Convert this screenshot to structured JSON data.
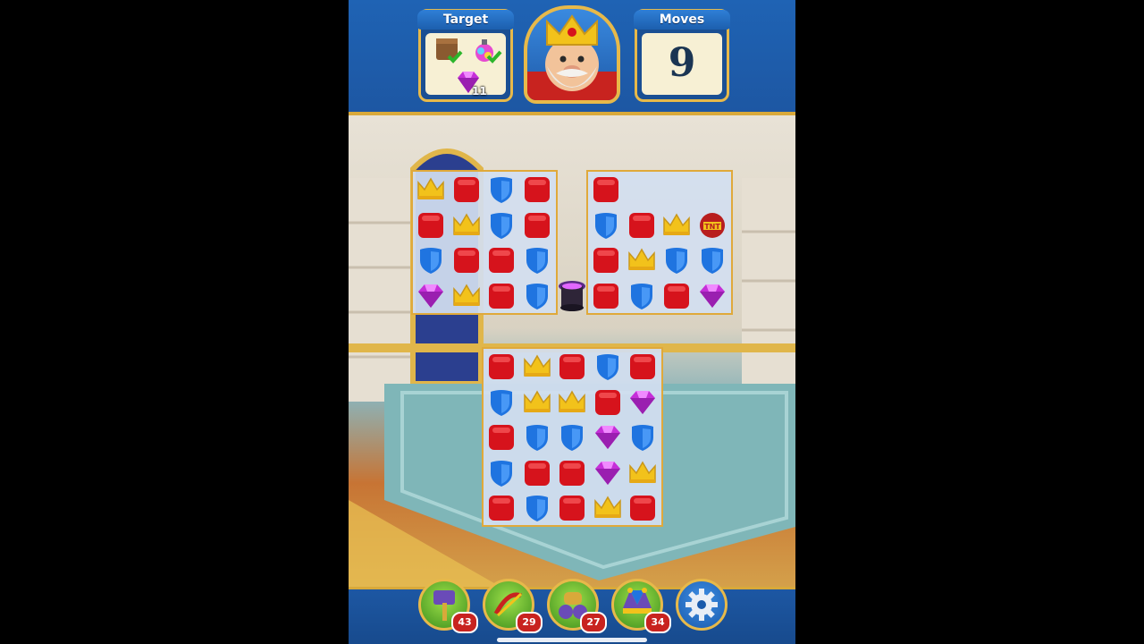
{
  "hud": {
    "target_label": "Target",
    "moves_label": "Moves",
    "moves_value": "9",
    "targets": [
      {
        "icon": "box-icon",
        "done": true
      },
      {
        "icon": "potion-icon",
        "done": true
      },
      {
        "icon": "gem-icon",
        "remaining": "11"
      }
    ]
  },
  "boosters": [
    {
      "icon": "hammer-icon",
      "count": "43"
    },
    {
      "icon": "arrow-icon",
      "count": "29"
    },
    {
      "icon": "cannon-icon",
      "count": "27"
    },
    {
      "icon": "jester-icon",
      "count": "34"
    }
  ],
  "colors": {
    "red": "#d6131c",
    "blue": "#1f74e0",
    "gold": "#f2c21b",
    "purple": "#c52fd8"
  },
  "boards": [
    {
      "id": "top-left",
      "rows": [
        [
          "crown",
          "red",
          "shield",
          "red"
        ],
        [
          "red",
          "crown",
          "shield",
          "red"
        ],
        [
          "shield",
          "red",
          "red",
          "shield"
        ],
        [
          "gem",
          "crown",
          "red",
          "shield"
        ]
      ]
    },
    {
      "id": "top-right",
      "rows": [
        [
          "red",
          "",
          "",
          ""
        ],
        [
          "shield",
          "red",
          "crown",
          "tnt"
        ],
        [
          "red",
          "crown",
          "shield",
          "shield"
        ],
        [
          "red",
          "shield",
          "red",
          "gem"
        ]
      ]
    },
    {
      "id": "bottom",
      "rows": [
        [
          "red",
          "crown",
          "red",
          "shield",
          "red"
        ],
        [
          "shield",
          "crown",
          "crown",
          "red",
          "gem"
        ],
        [
          "red",
          "shield",
          "shield",
          "gem",
          "shield"
        ],
        [
          "shield",
          "red",
          "red",
          "gem",
          "crown"
        ],
        [
          "red",
          "shield",
          "red",
          "crown",
          "red"
        ]
      ]
    }
  ]
}
